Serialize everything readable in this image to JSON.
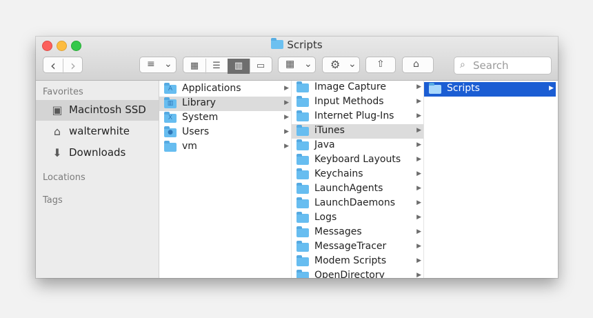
{
  "window": {
    "title": "Scripts"
  },
  "toolbar": {
    "back_glyph": "‹",
    "forward_glyph": "›",
    "arrange_glyph": "≡",
    "view_icons_glyph": "▦",
    "view_list_glyph": "☰",
    "view_columns_glyph": "▥",
    "view_gallery_glyph": "▭",
    "group_glyph": "▦",
    "action_glyph": "⚙",
    "chevron_glyph": "⌄",
    "share_glyph": "⇧",
    "tag_glyph": "⌂",
    "search_icon_glyph": "⌕",
    "search_placeholder": "Search",
    "active_view": "columns"
  },
  "sidebar": {
    "favorites_header": "Favorites",
    "items": [
      {
        "label": "Macintosh SSD",
        "icon": "hard-drive-icon",
        "glyph": "▣",
        "selected": true
      },
      {
        "label": "walterwhite",
        "icon": "home-icon",
        "glyph": "⌂",
        "selected": false
      },
      {
        "label": "Downloads",
        "icon": "downloads-icon",
        "glyph": "⬇",
        "selected": false
      }
    ],
    "locations_header": "Locations",
    "tags_header": "Tags"
  },
  "columns": [
    {
      "items": [
        {
          "name": "Applications",
          "glyph": "A",
          "has_children": true,
          "selected": false
        },
        {
          "name": "Library",
          "glyph": "▥",
          "has_children": true,
          "selected": true
        },
        {
          "name": "System",
          "glyph": "X",
          "has_children": true,
          "selected": false
        },
        {
          "name": "Users",
          "glyph": "●",
          "has_children": true,
          "selected": false
        },
        {
          "name": "vm",
          "glyph": "",
          "has_children": true,
          "selected": false
        }
      ]
    },
    {
      "items": [
        {
          "name": "Image Capture",
          "has_children": true,
          "selected": false
        },
        {
          "name": "Input Methods",
          "has_children": true,
          "selected": false
        },
        {
          "name": "Internet Plug-Ins",
          "has_children": true,
          "selected": false
        },
        {
          "name": "iTunes",
          "has_children": true,
          "selected": true
        },
        {
          "name": "Java",
          "has_children": true,
          "selected": false
        },
        {
          "name": "Keyboard Layouts",
          "has_children": true,
          "selected": false
        },
        {
          "name": "Keychains",
          "has_children": true,
          "selected": false
        },
        {
          "name": "LaunchAgents",
          "has_children": true,
          "selected": false
        },
        {
          "name": "LaunchDaemons",
          "has_children": true,
          "selected": false
        },
        {
          "name": "Logs",
          "has_children": true,
          "selected": false
        },
        {
          "name": "Messages",
          "has_children": true,
          "selected": false
        },
        {
          "name": "MessageTracer",
          "has_children": true,
          "selected": false
        },
        {
          "name": "Modem Scripts",
          "has_children": true,
          "selected": false
        },
        {
          "name": "OpenDirectory",
          "has_children": true,
          "selected": false
        }
      ]
    },
    {
      "items": [
        {
          "name": "Scripts",
          "has_children": true,
          "selected": true
        }
      ]
    }
  ],
  "arrow_glyph": "▶",
  "colors": {
    "selection_blue": "#1b5dd3",
    "selection_gray": "#dcdcdc",
    "folder_blue": "#67bdf0",
    "close": "#fc605c",
    "minimize": "#fdbc40",
    "maximize": "#34c84a"
  }
}
